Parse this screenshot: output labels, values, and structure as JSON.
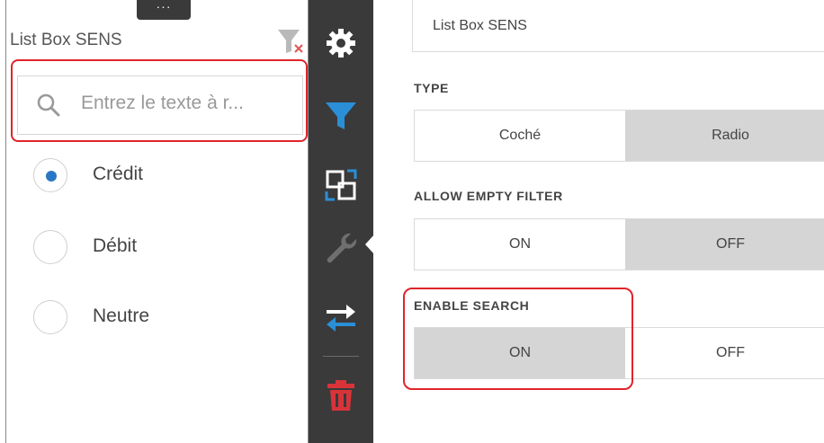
{
  "widget": {
    "title": "List Box SENS",
    "drag_handle": "···",
    "search": {
      "placeholder": "Entrez le texte à r..."
    },
    "items": [
      {
        "label": "Crédit",
        "checked": true
      },
      {
        "label": "Débit",
        "checked": false
      },
      {
        "label": "Neutre",
        "checked": false
      }
    ]
  },
  "toolbar": {
    "icons": [
      "gear-icon",
      "filter-icon",
      "resize-icon",
      "wrench-icon",
      "swap-arrows-icon",
      "trash-icon"
    ],
    "filter_color": "#2a8fd6",
    "delete_color": "#d9333a",
    "active_item": "wrench-icon"
  },
  "properties": {
    "name_value": "List Box  SENS",
    "type": {
      "label": "TYPE",
      "options": [
        "Coché",
        "Radio"
      ],
      "selected": "Radio"
    },
    "allow_empty_filter": {
      "label": "ALLOW EMPTY FILTER",
      "options": [
        "ON",
        "OFF"
      ],
      "selected": "OFF"
    },
    "enable_search": {
      "label": "ENABLE SEARCH",
      "options": [
        "ON",
        "OFF"
      ],
      "selected": "ON"
    }
  },
  "colors": {
    "highlight": "#e0242b",
    "accent": "#2a76c6",
    "toolbar_bg": "#3a3a3a"
  }
}
